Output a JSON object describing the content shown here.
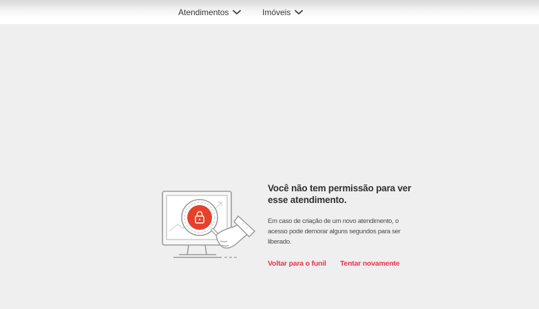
{
  "nav": {
    "items": [
      {
        "label": "Atendimentos",
        "icon": "chevron-down-icon"
      },
      {
        "label": "Imóveis",
        "icon": "chevron-down-icon"
      }
    ]
  },
  "message": {
    "title": "Você não tem permissão para ver esse atendimento.",
    "description": "Em caso de criação de um novo atendimento, o acesso pode demorar alguns segundos para ser liberado.",
    "illustration_icon": "no-permission-illustration"
  },
  "actions": {
    "back_label": "Voltar para o funil",
    "retry_label": "Tentar novamente"
  },
  "colors": {
    "accent": "#e8334a",
    "background": "#efefef",
    "lock_circle": "#e4422b"
  }
}
